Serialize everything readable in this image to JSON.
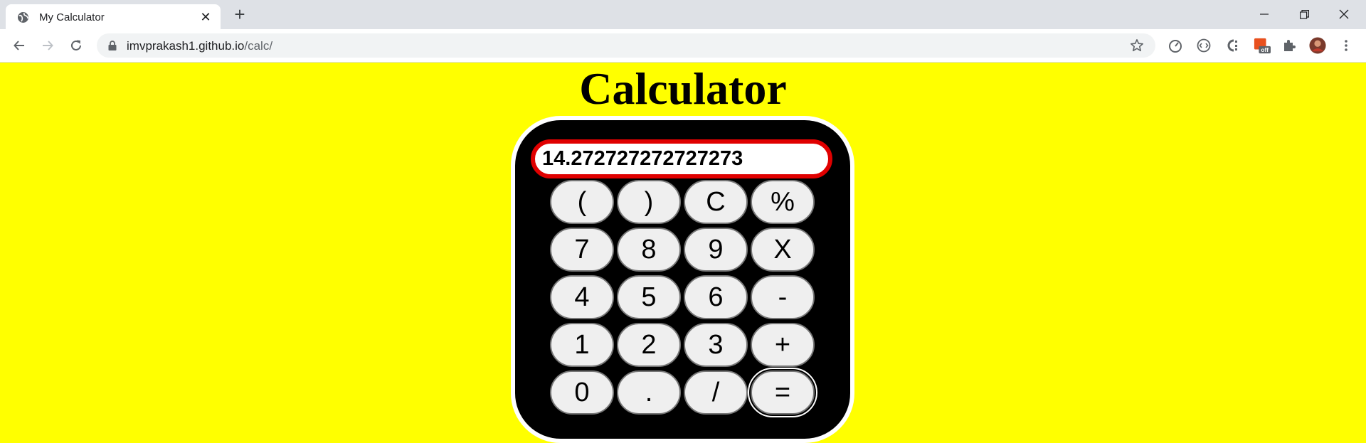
{
  "browser": {
    "tab_title": "My Calculator",
    "url_host": "imvprakash1.github.io",
    "url_path": "/calc/",
    "extensions": [
      "speed-dial-icon",
      "code-icon",
      "c-icon",
      "off-badge-extension-icon",
      "puzzle-icon",
      "profile-avatar"
    ],
    "extension_badge": "off"
  },
  "page": {
    "title": "Calculator",
    "background_color": "#ffff00"
  },
  "calculator": {
    "display_value": "14.272727272727273",
    "display_border_color": "#e00000",
    "keys": [
      {
        "label": "(",
        "name": "open-paren-button"
      },
      {
        "label": ")",
        "name": "close-paren-button"
      },
      {
        "label": "C",
        "name": "clear-button"
      },
      {
        "label": "%",
        "name": "percent-button"
      },
      {
        "label": "7",
        "name": "digit-7-button"
      },
      {
        "label": "8",
        "name": "digit-8-button"
      },
      {
        "label": "9",
        "name": "digit-9-button"
      },
      {
        "label": "X",
        "name": "multiply-button"
      },
      {
        "label": "4",
        "name": "digit-4-button"
      },
      {
        "label": "5",
        "name": "digit-5-button"
      },
      {
        "label": "6",
        "name": "digit-6-button"
      },
      {
        "label": "-",
        "name": "subtract-button"
      },
      {
        "label": "1",
        "name": "digit-1-button"
      },
      {
        "label": "2",
        "name": "digit-2-button"
      },
      {
        "label": "3",
        "name": "digit-3-button"
      },
      {
        "label": "+",
        "name": "add-button"
      },
      {
        "label": "0",
        "name": "digit-0-button"
      },
      {
        "label": ".",
        "name": "decimal-button"
      },
      {
        "label": "/",
        "name": "divide-button"
      },
      {
        "label": "=",
        "name": "equals-button"
      }
    ]
  }
}
